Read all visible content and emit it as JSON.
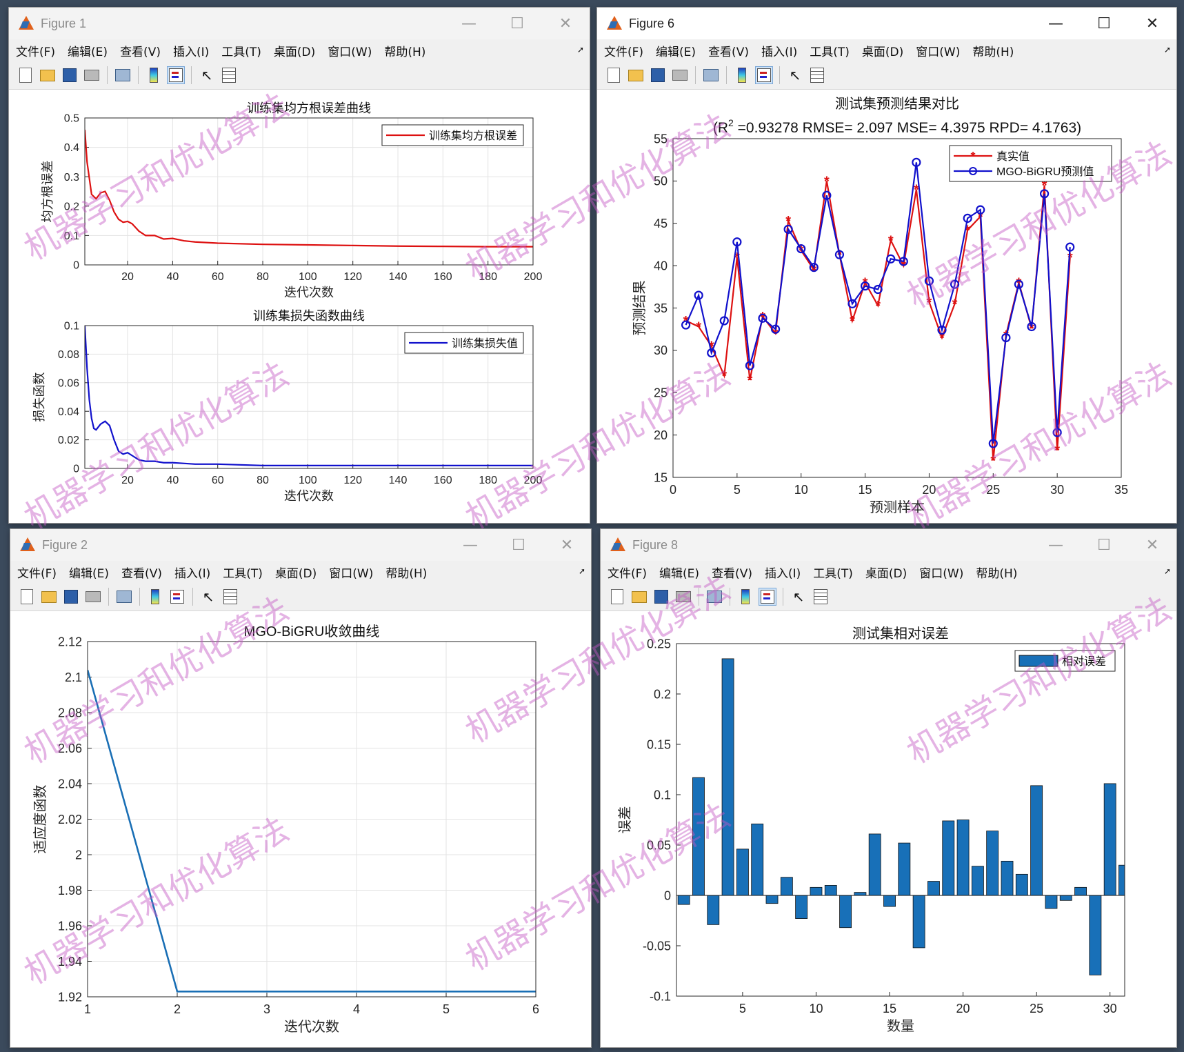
{
  "menu_items": [
    "文件(F)",
    "编辑(E)",
    "查看(V)",
    "插入(I)",
    "工具(T)",
    "桌面(D)",
    "窗口(W)",
    "帮助(H)"
  ],
  "watermark_text": "机器学习和优化算法",
  "windows": {
    "fig1": {
      "title": "Figure 1",
      "active": false
    },
    "fig6": {
      "title": "Figure 6",
      "active": true
    },
    "fig2": {
      "title": "Figure 2",
      "active": false
    },
    "fig8": {
      "title": "Figure 8",
      "active": false
    }
  },
  "colors": {
    "red_series": "#dd1111",
    "blue_series": "#1111cc",
    "bar": "#1870b8",
    "line_convergence": "#1a6fb5"
  },
  "chart_data": [
    {
      "id": "rmse",
      "type": "line",
      "title": "训练集均方根误差曲线",
      "xlabel": "迭代次数",
      "ylabel": "均方根误差",
      "xlim": [
        1,
        200
      ],
      "ylim": [
        0,
        0.5
      ],
      "xticks": [
        20,
        40,
        60,
        80,
        100,
        120,
        140,
        160,
        180,
        200
      ],
      "yticks": [
        0,
        0.1,
        0.2,
        0.3,
        0.4,
        0.5
      ],
      "grid": true,
      "legend": "top-right",
      "series": [
        {
          "name": "训练集均方根误差",
          "color": "#dd1111",
          "x": [
            1,
            2,
            4,
            6,
            8,
            10,
            12,
            14,
            16,
            18,
            20,
            22,
            25,
            28,
            32,
            36,
            40,
            45,
            50,
            60,
            80,
            100,
            120,
            140,
            160,
            180,
            200
          ],
          "y": [
            0.46,
            0.35,
            0.24,
            0.225,
            0.245,
            0.25,
            0.22,
            0.18,
            0.155,
            0.145,
            0.148,
            0.14,
            0.115,
            0.1,
            0.1,
            0.088,
            0.09,
            0.082,
            0.078,
            0.074,
            0.07,
            0.068,
            0.066,
            0.064,
            0.063,
            0.062,
            0.062
          ]
        }
      ]
    },
    {
      "id": "loss",
      "type": "line",
      "title": "训练集损失函数曲线",
      "xlabel": "迭代次数",
      "ylabel": "损失函数",
      "xlim": [
        1,
        200
      ],
      "ylim": [
        0,
        0.1
      ],
      "xticks": [
        20,
        40,
        60,
        80,
        100,
        120,
        140,
        160,
        180,
        200
      ],
      "yticks": [
        0,
        0.02,
        0.04,
        0.06,
        0.08,
        0.1
      ],
      "ytick_labels": [
        "0",
        "0.02",
        "0.04",
        "0.06",
        "0.08",
        "0.1"
      ],
      "grid": true,
      "legend": "top-right",
      "series": [
        {
          "name": "训练集损失值",
          "color": "#1111cc",
          "x": [
            1,
            2,
            3,
            4,
            5,
            6,
            8,
            10,
            12,
            14,
            16,
            18,
            20,
            22,
            25,
            28,
            32,
            36,
            40,
            50,
            60,
            80,
            100,
            140,
            200
          ],
          "y": [
            0.1,
            0.07,
            0.048,
            0.035,
            0.028,
            0.027,
            0.031,
            0.033,
            0.03,
            0.02,
            0.012,
            0.01,
            0.011,
            0.009,
            0.006,
            0.005,
            0.005,
            0.004,
            0.004,
            0.003,
            0.003,
            0.002,
            0.002,
            0.002,
            0.002
          ]
        }
      ]
    },
    {
      "id": "pred",
      "type": "line",
      "title": "测试集预测结果对比",
      "subtitle_parts": [
        "(R",
        "2",
        " =0.93278 RMSE= 2.097 MSE= 4.3975 RPD= 4.1763)"
      ],
      "xlabel": "预测样本",
      "ylabel": "预测结果",
      "xlim": [
        0,
        35
      ],
      "ylim": [
        15,
        55
      ],
      "xticks": [
        0,
        5,
        10,
        15,
        20,
        25,
        30,
        35
      ],
      "yticks": [
        15,
        20,
        25,
        30,
        35,
        40,
        45,
        50,
        55
      ],
      "grid": false,
      "legend": "top-right",
      "series": [
        {
          "name": "真实值",
          "color": "#dd1111",
          "marker": "star",
          "x": [
            1,
            2,
            3,
            4,
            5,
            6,
            7,
            8,
            9,
            10,
            11,
            12,
            13,
            14,
            15,
            16,
            17,
            18,
            19,
            20,
            21,
            22,
            23,
            24,
            25,
            26,
            27,
            28,
            29,
            30,
            31
          ],
          "y": [
            33.5,
            32.8,
            30.5,
            27,
            41,
            26.5,
            34,
            32,
            45.3,
            41.8,
            39.5,
            50,
            41.3,
            33.5,
            38,
            35.3,
            43,
            40,
            49,
            35.7,
            31.5,
            35.5,
            44.2,
            45.8,
            17,
            31.8,
            38,
            32.6,
            49.5,
            18.2,
            41
          ]
        },
        {
          "name": "MGO-BiGRU预测值",
          "color": "#1111cc",
          "marker": "circle",
          "x": [
            1,
            2,
            3,
            4,
            5,
            6,
            7,
            8,
            9,
            10,
            11,
            12,
            13,
            14,
            15,
            16,
            17,
            18,
            19,
            20,
            21,
            22,
            23,
            24,
            25,
            26,
            27,
            28,
            29,
            30,
            31
          ],
          "y": [
            33,
            36.5,
            29.7,
            33.5,
            42.8,
            28.2,
            33.8,
            32.5,
            44.3,
            42,
            39.8,
            48.3,
            41.3,
            35.5,
            37.6,
            37.2,
            40.8,
            40.5,
            52.2,
            38.2,
            32.4,
            37.8,
            45.6,
            46.6,
            19,
            31.5,
            37.8,
            32.8,
            48.5,
            20.3,
            42.2
          ]
        }
      ]
    },
    {
      "id": "convergence",
      "type": "line",
      "title": "MGO-BiGRU收敛曲线",
      "xlabel": "迭代次数",
      "ylabel": "适应度函数",
      "xlim": [
        1,
        6
      ],
      "ylim": [
        1.92,
        2.12
      ],
      "xticks": [
        1,
        2,
        3,
        4,
        5,
        6
      ],
      "yticks": [
        1.92,
        1.94,
        1.96,
        1.98,
        2,
        2.02,
        2.04,
        2.06,
        2.08,
        2.1,
        2.12
      ],
      "ytick_labels": [
        "1.92",
        "1.94",
        "1.96",
        "1.98",
        "2",
        "2.02",
        "2.04",
        "2.06",
        "2.08",
        "2.1",
        "2.12"
      ],
      "grid": true,
      "legend": "none",
      "series": [
        {
          "name": "",
          "color": "#1a6fb5",
          "x": [
            1,
            2,
            3,
            4,
            5,
            6
          ],
          "y": [
            2.104,
            1.923,
            1.923,
            1.923,
            1.923,
            1.923
          ]
        }
      ]
    },
    {
      "id": "relerr",
      "type": "bar",
      "title": "测试集相对误差",
      "xlabel": "数量",
      "ylabel": "误差",
      "xlim": [
        0.5,
        31
      ],
      "ylim": [
        -0.1,
        0.25
      ],
      "xticks": [
        5,
        10,
        15,
        20,
        25,
        30
      ],
      "yticks": [
        -0.1,
        -0.05,
        0,
        0.05,
        0.1,
        0.15,
        0.2,
        0.25
      ],
      "ytick_labels": [
        "-0.1",
        "-0.05",
        "0",
        "0.05",
        "0.1",
        "0.15",
        "0.2",
        "0.25"
      ],
      "grid": false,
      "legend": "top-right",
      "series": [
        {
          "name": "相对误差",
          "color": "#1870b8",
          "x": [
            1,
            2,
            3,
            4,
            5,
            6,
            7,
            8,
            9,
            10,
            11,
            12,
            13,
            14,
            15,
            16,
            17,
            18,
            19,
            20,
            21,
            22,
            23,
            24,
            25,
            26,
            27,
            28,
            29,
            30,
            31
          ],
          "values": [
            -0.009,
            0.117,
            -0.029,
            0.235,
            0.046,
            0.071,
            -0.008,
            0.018,
            -0.023,
            0.008,
            0.01,
            -0.032,
            0.003,
            0.061,
            -0.011,
            0.052,
            -0.052,
            0.014,
            0.074,
            0.075,
            0.029,
            0.064,
            0.034,
            0.021,
            0.109,
            -0.013,
            -0.005,
            0.008,
            -0.079,
            0.111,
            0.03
          ]
        }
      ]
    }
  ]
}
